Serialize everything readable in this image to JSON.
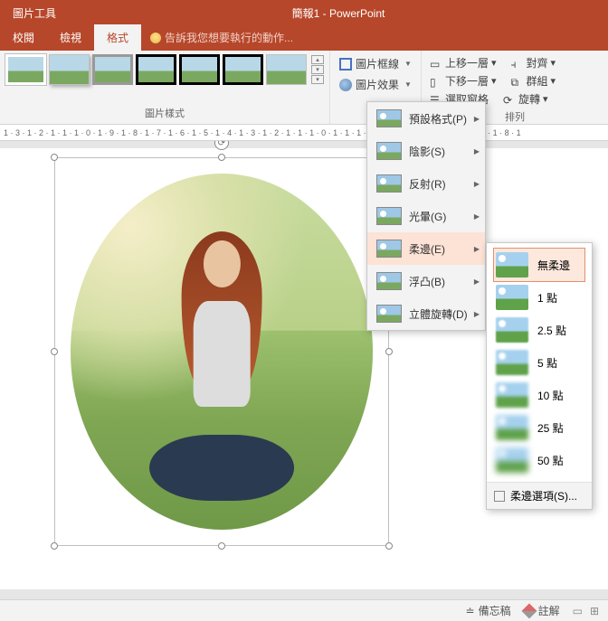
{
  "titlebar": {
    "tool_tab": "圖片工具",
    "title": "簡報1 - PowerPoint"
  },
  "tabs": {
    "review": "校閱",
    "view": "檢視",
    "format": "格式",
    "tell_me": "告訴我您想要執行的動作..."
  },
  "ribbon": {
    "styles_label": "圖片樣式",
    "arrange_label": "排列",
    "border": "圖片框線",
    "effects": "圖片效果",
    "bring_forward": "上移一層",
    "send_backward": "下移一層",
    "selection_pane": "選取窗格",
    "align": "對齊",
    "group": "群組",
    "rotate": "旋轉"
  },
  "ruler": "1 · 3 · 1 · 2 · 1 · 1 · 1 · 0 · 1 · 9 · 1 · 8 · 1 · 7 · 1 · 6 · 1 · 5 · 1 · 4 · 1 · 3 · 1 · 2 · 1 · 1 · 1 · 0 · 1 · 1 · 1 · 2 · 1 · 3 · 1 · 4 · 1   5 · 1 · 6 · 1 · 7 · 1 · 8 · 1",
  "effects_menu": {
    "preset": "預設格式(P)",
    "shadow": "陰影(S)",
    "reflection": "反射(R)",
    "glow": "光暈(G)",
    "soft_edges": "柔邊(E)",
    "bevel": "浮凸(B)",
    "rotation3d": "立體旋轉(D)"
  },
  "soft_edges": {
    "none": "無柔邊",
    "p1": "1 點",
    "p25": "2.5 點",
    "p5": "5 點",
    "p10": "10 點",
    "p25b": "25 點",
    "p50": "50 點",
    "options": "柔邊選項(S)..."
  },
  "status": {
    "notes": "備忘稿",
    "comments": "註解"
  }
}
